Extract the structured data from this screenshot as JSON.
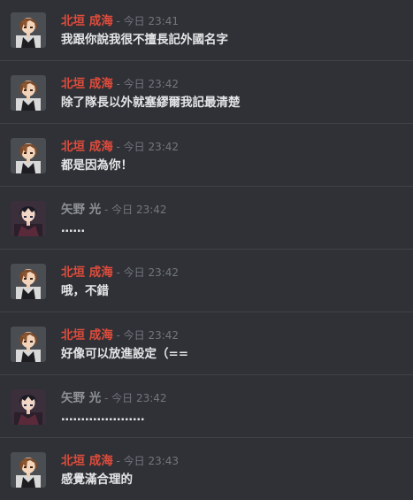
{
  "colors": {
    "background": "#2f3136",
    "name_beigan": "#e04c3c",
    "name_yano": "#8e9297",
    "timestamp": "#72767d",
    "message_text": "#e4e5e7",
    "divider": "#3f4247"
  },
  "separator": " - ",
  "messages": [
    {
      "author": "北垣 成海",
      "avatar": "brown-hair-avatar-icon",
      "color": "#e04c3c",
      "time": "今日 23:41",
      "text": "我跟你說我很不擅長記外國名字"
    },
    {
      "author": "北垣 成海",
      "avatar": "brown-hair-avatar-icon",
      "color": "#e04c3c",
      "time": "今日 23:42",
      "text": "除了隊長以外就塞繆爾我記最清楚"
    },
    {
      "author": "北垣 成海",
      "avatar": "brown-hair-avatar-icon",
      "color": "#e04c3c",
      "time": "今日 23:42",
      "text": "都是因為你！"
    },
    {
      "author": "矢野 光",
      "avatar": "dark-hair-avatar-icon",
      "color": "#8e9297",
      "time": "今日 23:42",
      "text": "……"
    },
    {
      "author": "北垣 成海",
      "avatar": "brown-hair-avatar-icon",
      "color": "#e04c3c",
      "time": "今日 23:42",
      "text": "哦，不錯"
    },
    {
      "author": "北垣 成海",
      "avatar": "brown-hair-avatar-icon",
      "color": "#e04c3c",
      "time": "今日 23:42",
      "text": "好像可以放進設定（=="
    },
    {
      "author": "矢野 光",
      "avatar": "dark-hair-avatar-icon",
      "color": "#8e9297",
      "time": "今日 23:42",
      "text": "…………………"
    },
    {
      "author": "北垣 成海",
      "avatar": "brown-hair-avatar-icon",
      "color": "#e04c3c",
      "time": "今日 23:43",
      "text": "感覺滿合理的"
    }
  ]
}
